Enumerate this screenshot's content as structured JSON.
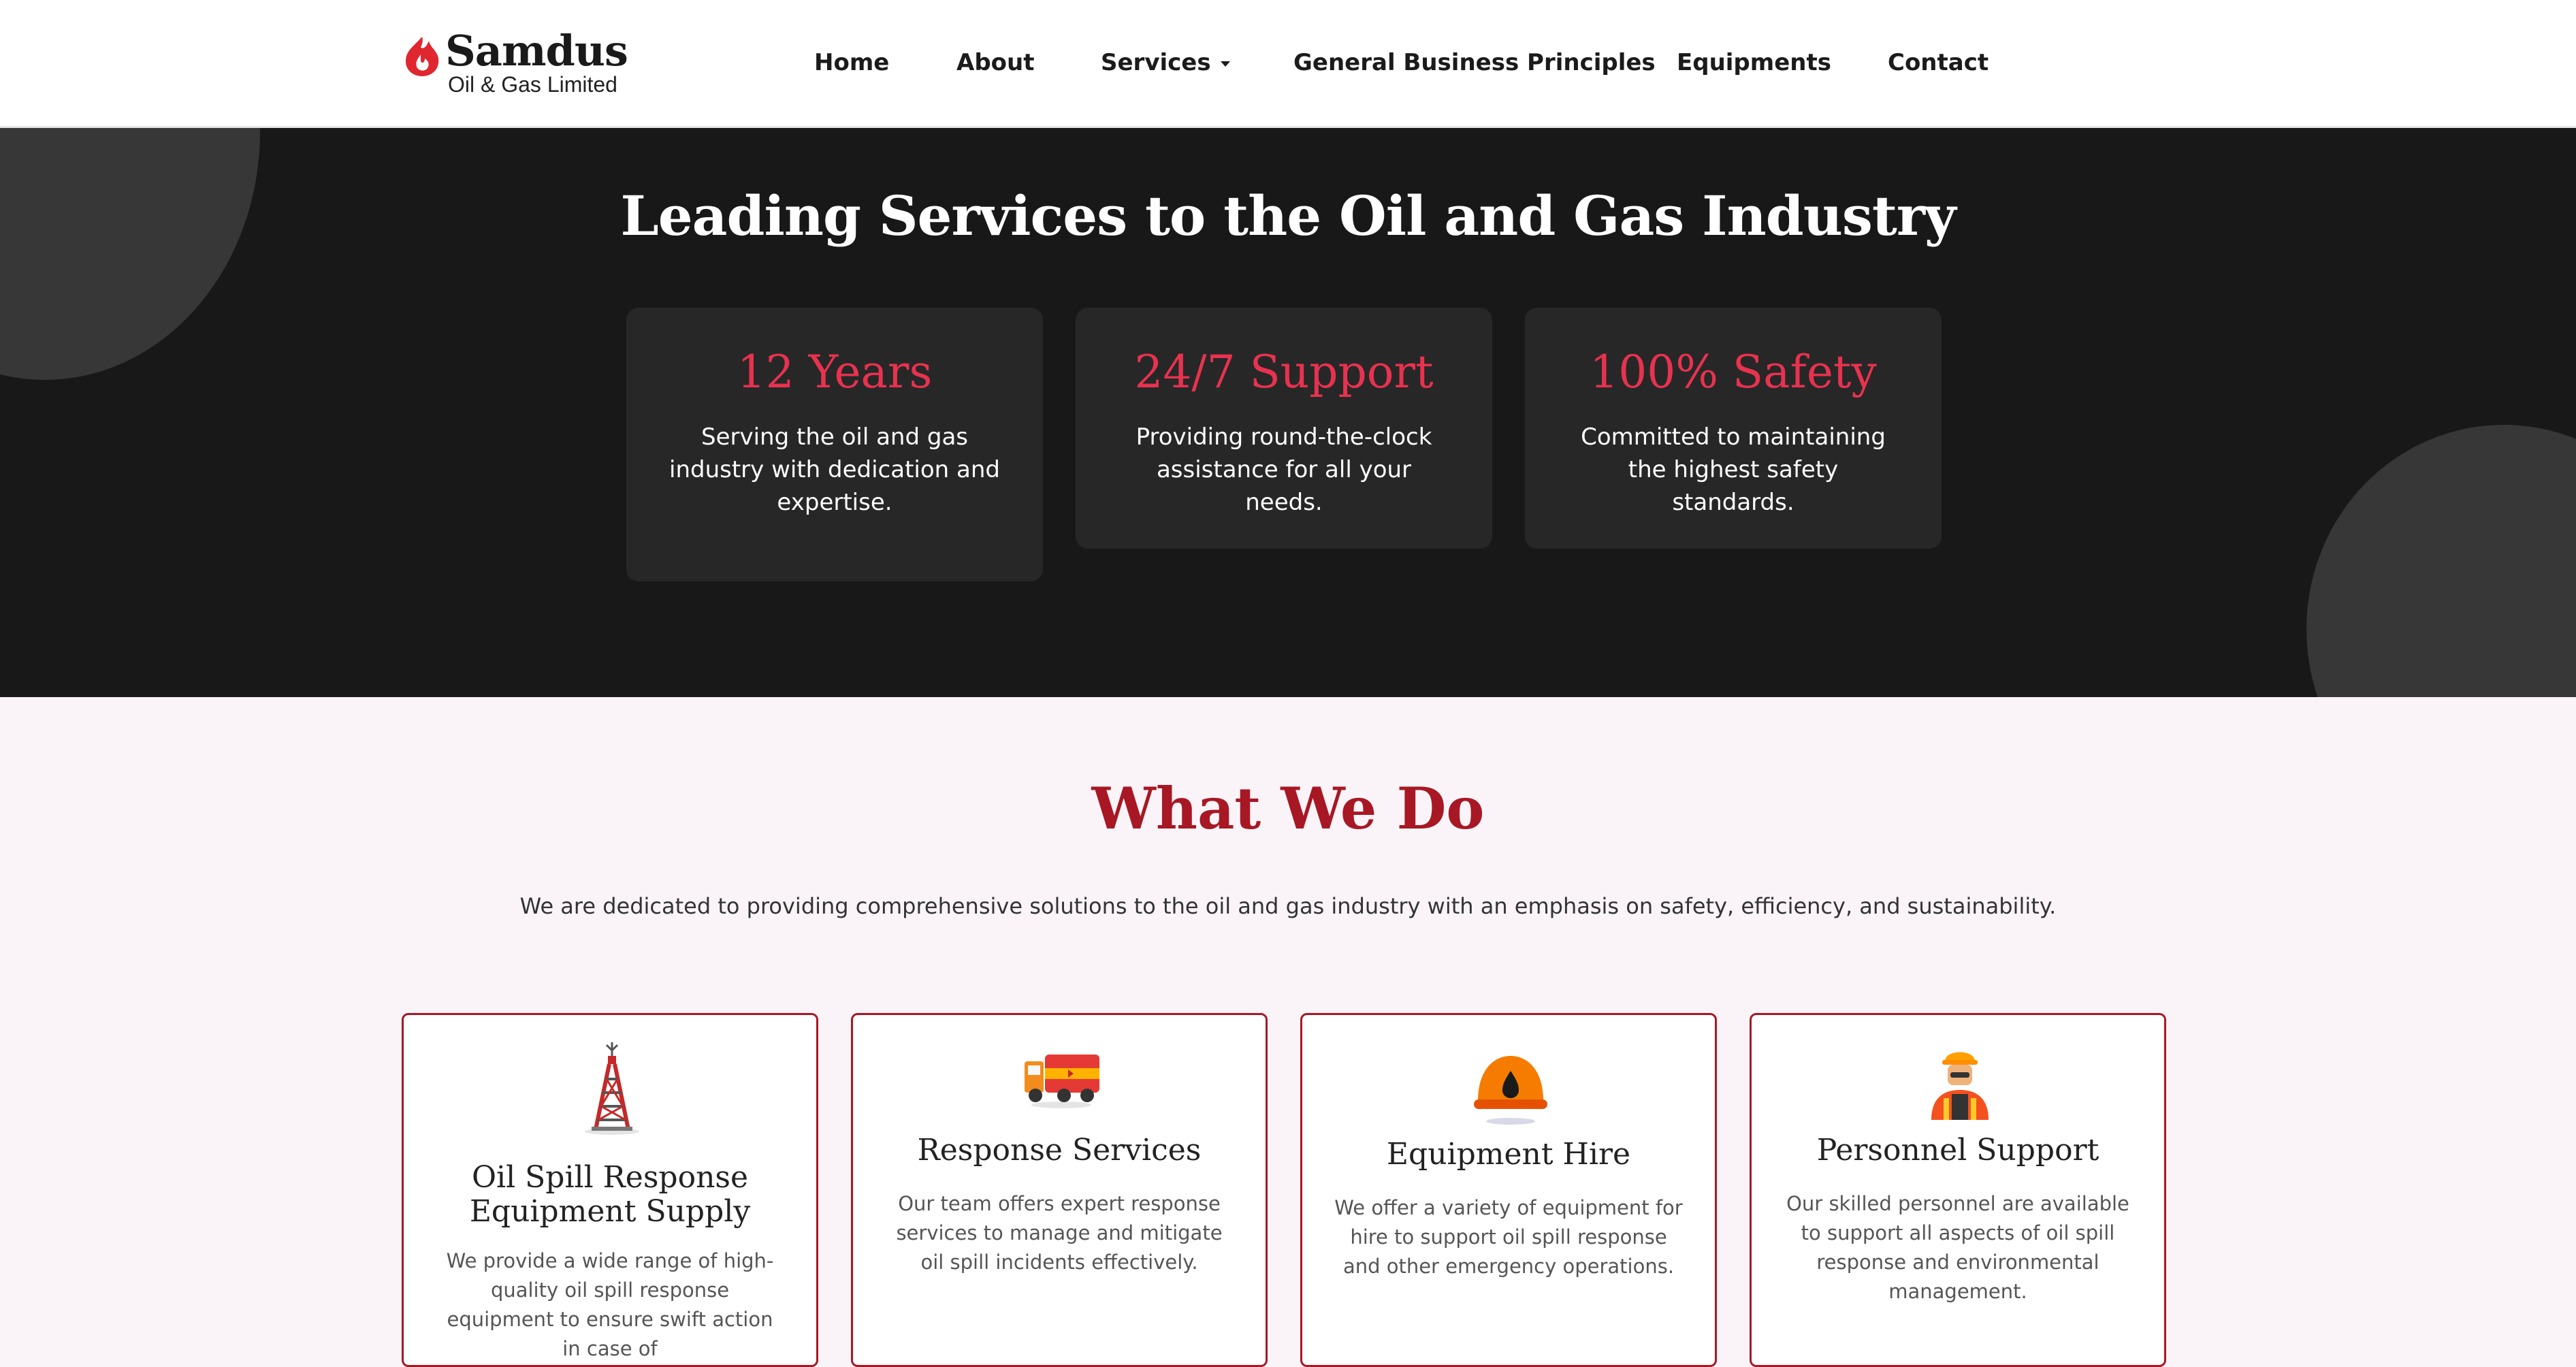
{
  "brand": {
    "name": "Samdus",
    "subtitle": "Oil & Gas Limited",
    "accent": "#e0262f"
  },
  "nav": {
    "home": "Home",
    "about": "About",
    "services": "Services",
    "principles": "General Business Principles",
    "equipments": "Equipments",
    "contact": "Contact"
  },
  "hero": {
    "title": "Leading Services to the Oil and Gas Industry",
    "stats": [
      {
        "title": "12 Years",
        "text": "Serving the oil and gas industry with dedication and expertise."
      },
      {
        "title": "24/7 Support",
        "text": "Providing round-the-clock assistance for all your needs."
      },
      {
        "title": "100% Safety",
        "text": "Committed to maintaining the highest safety standards."
      }
    ]
  },
  "what_we_do": {
    "title": "What We Do",
    "description": "We are dedicated to providing comprehensive solutions to the oil and gas industry with an emphasis on safety, efficiency, and sustainability.",
    "cards": [
      {
        "icon": "oil-rig-icon",
        "title": "Oil Spill Response Equipment Supply",
        "text": "We provide a wide range of high-quality oil spill response equipment to ensure swift action in case of"
      },
      {
        "icon": "tanker-truck-icon",
        "title": "Response Services",
        "text": "Our team offers expert response services to manage and mitigate oil spill incidents effectively."
      },
      {
        "icon": "hard-hat-icon",
        "title": "Equipment Hire",
        "text": "We offer a variety of equipment for hire to support oil spill response and other emergency operations."
      },
      {
        "icon": "worker-icon",
        "title": "Personnel Support",
        "text": "Our skilled personnel are available to support all aspects of oil spill response and environmental management."
      }
    ]
  },
  "colors": {
    "hero_bg": "#181818",
    "stat_accent": "#e8324f",
    "heading_red": "#a71824"
  }
}
